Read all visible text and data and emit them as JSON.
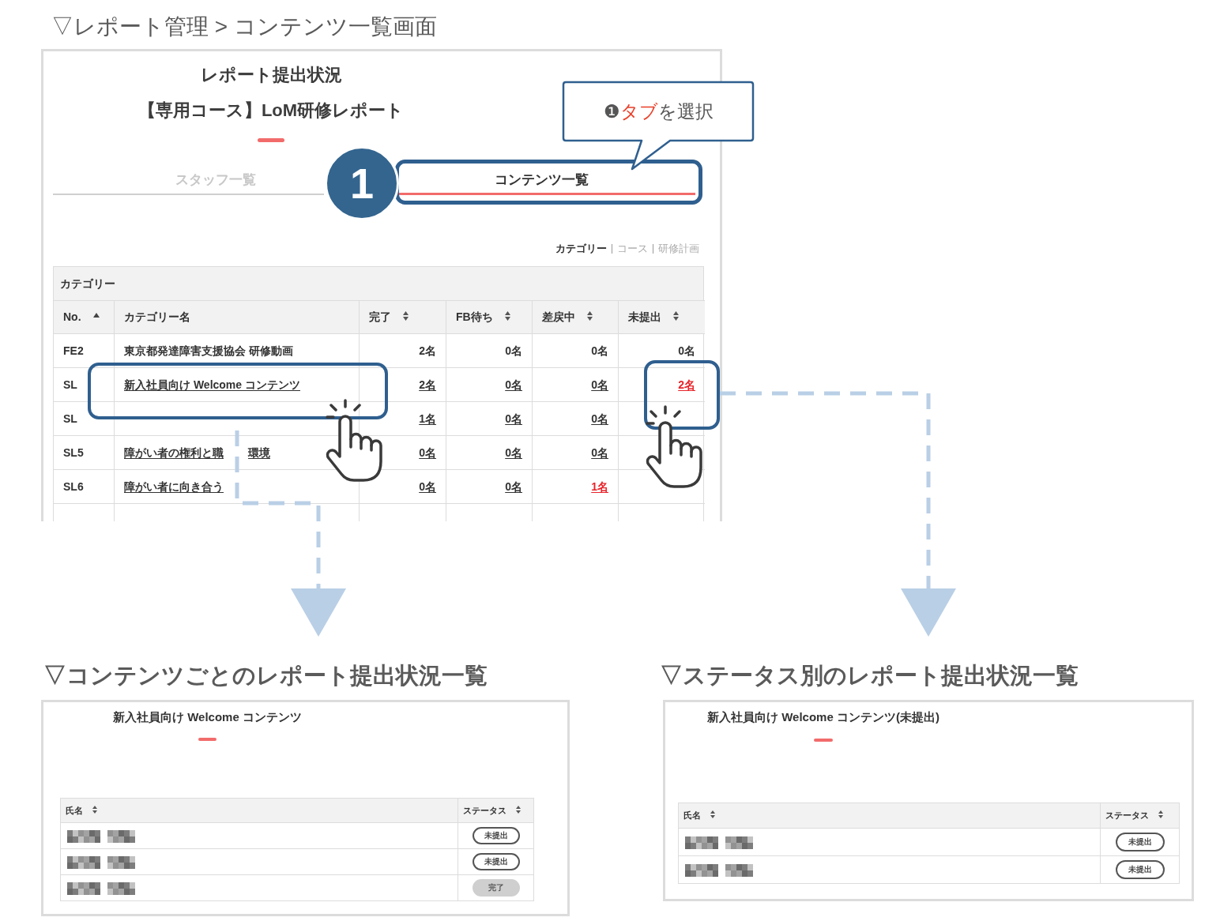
{
  "section_title": "▽レポート管理 > コンテンツ一覧画面",
  "report_screen": {
    "title": "レポート提出状況",
    "subtitle": "【専用コース】LoM研修レポート",
    "tabs": [
      {
        "label": "スタッフ一覧",
        "selected": false
      },
      {
        "label": "コンテンツ一覧",
        "selected": true
      }
    ],
    "view_links": [
      {
        "label": "カテゴリー",
        "selected": true
      },
      {
        "label": "コース",
        "selected": false
      },
      {
        "label": "研修計画",
        "selected": false
      }
    ],
    "table": {
      "caption": "カテゴリー",
      "columns": [
        {
          "label": "No.",
          "kind": "ascending"
        },
        {
          "label": "カテゴリー名",
          "kind": "plain"
        },
        {
          "label": "完了",
          "kind": "sortable"
        },
        {
          "label": "FB待ち",
          "kind": "sortable"
        },
        {
          "label": "差戻中",
          "kind": "sortable"
        },
        {
          "label": "未提出",
          "kind": "sortable"
        }
      ],
      "rows": [
        {
          "no": "FE2",
          "name": [
            "東京都発達障害支援協会 研修動画"
          ],
          "link": false,
          "counts": [
            {
              "text": "2名",
              "highlighted": false
            },
            {
              "text": "0名",
              "highlighted": false
            },
            {
              "text": "0名",
              "highlighted": false
            },
            {
              "text": "0名",
              "highlighted": false
            }
          ]
        },
        {
          "no": "SL",
          "name": [
            "新入社員向け Welcome コンテンツ"
          ],
          "link": true,
          "counts": [
            {
              "text": "2名",
              "highlighted": false
            },
            {
              "text": "0名",
              "highlighted": false
            },
            {
              "text": "0名",
              "highlighted": false
            },
            {
              "text": "2名",
              "highlighted": true
            }
          ]
        },
        {
          "no": "SL",
          "link": true,
          "counts": [
            {
              "text": "1名",
              "highlighted": false
            },
            {
              "text": "0名",
              "highlighted": false
            },
            {
              "text": "0名",
              "highlighted": false
            }
          ]
        },
        {
          "no": "SL5",
          "name": [
            "障がい者の権利と職",
            "環境"
          ],
          "link": true,
          "counts": [
            {
              "text": "0名",
              "highlighted": false
            },
            {
              "text": "0名",
              "highlighted": false
            },
            {
              "text": "0名",
              "highlighted": false
            }
          ]
        },
        {
          "no": "SL6",
          "name": [
            "障がい者に向き合う"
          ],
          "link": true,
          "counts": [
            {
              "text": "0名",
              "highlighted": false
            },
            {
              "text": "0名",
              "highlighted": false
            },
            {
              "text": "1名",
              "highlighted": true
            }
          ]
        }
      ]
    }
  },
  "annotations": {
    "callout": [
      {
        "text": "❶",
        "highlighted": false
      },
      {
        "text": "タブ",
        "highlighted": true
      },
      {
        "text": "を選択",
        "highlighted": false
      }
    ],
    "step_number": "1"
  },
  "contents_view": {
    "heading": "▽コンテンツごとのレポート提出状況一覧",
    "title": "新入社員向け Welcome コンテンツ",
    "columns": [
      {
        "label": "氏名",
        "kind": "sortable"
      },
      {
        "label": "ステータス",
        "kind": "sortable"
      }
    ],
    "rows": [
      {
        "redacted_name": true,
        "status": {
          "label": "未提出",
          "kind": "pending"
        }
      },
      {
        "redacted_name": true,
        "status": {
          "label": "未提出",
          "kind": "pending"
        }
      },
      {
        "redacted_name": true,
        "status": {
          "label": "完了",
          "kind": "done"
        }
      }
    ]
  },
  "status_view": {
    "heading": "▽ステータス別のレポート提出状況一覧",
    "title": "新入社員向け Welcome コンテンツ(未提出)",
    "columns": [
      {
        "label": "氏名",
        "kind": "sortable"
      },
      {
        "label": "ステータス",
        "kind": "sortable"
      }
    ],
    "rows": [
      {
        "redacted_name": true,
        "status": {
          "label": "未提出",
          "kind": "pending"
        }
      },
      {
        "redacted_name": true,
        "status": {
          "label": "未提出",
          "kind": "pending"
        }
      }
    ]
  }
}
